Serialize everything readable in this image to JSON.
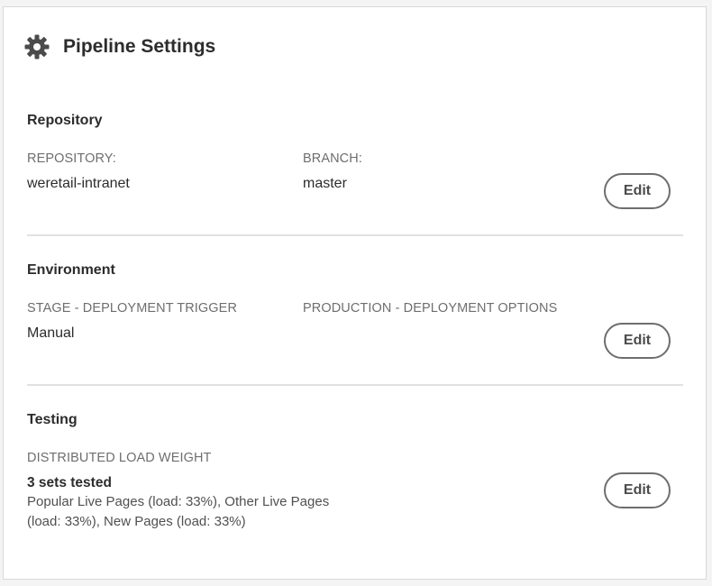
{
  "header": {
    "icon": "gear-icon",
    "title": "Pipeline Settings"
  },
  "repository": {
    "title": "Repository",
    "repo_label": "REPOSITORY:",
    "repo_value": "weretail-intranet",
    "branch_label": "BRANCH:",
    "branch_value": "master",
    "edit_label": "Edit"
  },
  "environment": {
    "title": "Environment",
    "stage_label": "STAGE - DEPLOYMENT TRIGGER",
    "stage_value": "Manual",
    "production_label": "PRODUCTION - DEPLOYMENT OPTIONS",
    "edit_label": "Edit"
  },
  "testing": {
    "title": "Testing",
    "load_label": "DISTRIBUTED LOAD WEIGHT",
    "sets_tested": "3 sets tested",
    "sets_line1": "Popular Live Pages (load: 33%), Other Live Pages",
    "sets_line2": "(load: 33%), New Pages (load: 33%)",
    "edit_label": "Edit"
  },
  "colors": {
    "text": "#2c2c2c",
    "label": "#6e6e6e",
    "divider": "#e1e1e1",
    "button_border": "#6e6e6e"
  }
}
